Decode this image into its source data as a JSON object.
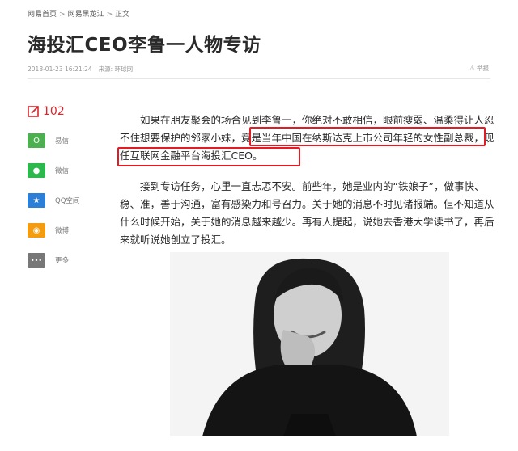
{
  "breadcrumb": {
    "home": "网易首页",
    "section": "网易黑龙江",
    "current": "正文",
    "separator": ">"
  },
  "article": {
    "title": "海投汇CEO李鲁一人物专访",
    "datetime": "2018-01-23 16:21:24",
    "source_label": "来源: 环球网",
    "report_label": "举报",
    "paragraph1_a": "如果在朋友聚会的场合见到李鲁一，你绝对不敢相信，眼前瘦弱、温柔得让人忍不住想要保护的邻家小妹，",
    "paragraph1_b": "竟是当年中国在纳斯达克上市公司年轻的女性副总裁，现任互联网金融平台海投汇CEO。",
    "paragraph2": "接到专访任务，心里一直忐忑不安。前些年，她是业内的“铁娘子”，做事快、稳、准，善于沟通，富有感染力和号召力。关于她的消息不时见诸报端。但不知道从什么时候开始，关于她的消息越来越少。再有人提起，说她去香港大学读书了，再后来就听说她创立了投汇。"
  },
  "sidebar": {
    "comment_count": "102",
    "share": [
      {
        "label": "易信",
        "icon": "yixin-icon",
        "color": "#4caf50",
        "glyph": "O"
      },
      {
        "label": "微信",
        "icon": "wechat-icon",
        "color": "#2db84d",
        "glyph": "●"
      },
      {
        "label": "QQ空间",
        "icon": "qzone-icon",
        "color": "#2b7fd6",
        "glyph": "★"
      },
      {
        "label": "微博",
        "icon": "weibo-icon",
        "color": "#f39c12",
        "glyph": "◉"
      },
      {
        "label": "更多",
        "icon": "more-icon",
        "color": "#777777",
        "glyph": "•••"
      }
    ]
  },
  "colors": {
    "accent_red": "#d8262b",
    "highlight_red": "#e41b22"
  }
}
